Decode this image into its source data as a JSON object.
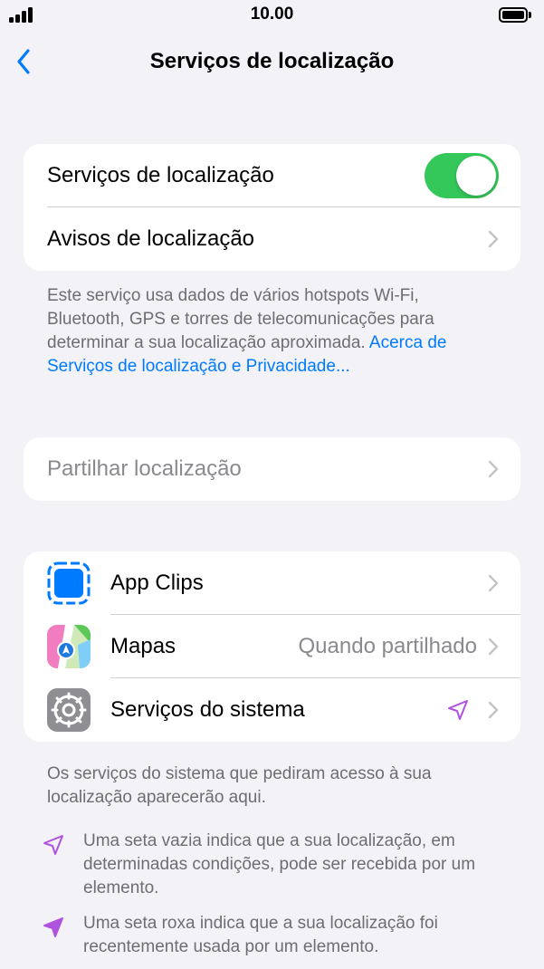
{
  "status": {
    "time": "10.00"
  },
  "nav": {
    "title": "Serviços de localização"
  },
  "group1": {
    "toggle_label": "Serviços de localização",
    "toggle_on": true,
    "alerts_label": "Avisos de localização"
  },
  "footer1": {
    "text": "Este serviço usa dados de vários hotspots Wi-Fi, Bluetooth, GPS e torres de telecomunicações para determinar a sua localização aproximada. ",
    "link": "Acerca de Serviços de localização e Privacidade..."
  },
  "group2": {
    "share_label": "Partilhar localização"
  },
  "apps": [
    {
      "label": "App Clips",
      "value": "",
      "icon": "app-clips-icon"
    },
    {
      "label": "Mapas",
      "value": "Quando partilhado",
      "icon": "maps-icon"
    },
    {
      "label": "Serviços do sistema",
      "value": "",
      "icon": "settings-gear-icon",
      "indicator": "location-arrow-outline-icon"
    }
  ],
  "footer2": {
    "text": "Os serviços do sistema que pediram acesso à sua localização aparecerão aqui."
  },
  "legend": [
    {
      "icon": "hollow-arrow-icon",
      "text": "Uma seta vazia indica que a sua localização, em determinadas condições, pode ser recebida por um elemento."
    },
    {
      "icon": "purple-arrow-icon",
      "text": "Uma seta roxa indica que a sua localização foi recentemente usada por um elemento."
    }
  ],
  "colors": {
    "accent": "#007aff",
    "toggle_on": "#34c759",
    "purple": "#af52de",
    "secondary_text": "#8a8a8e"
  }
}
